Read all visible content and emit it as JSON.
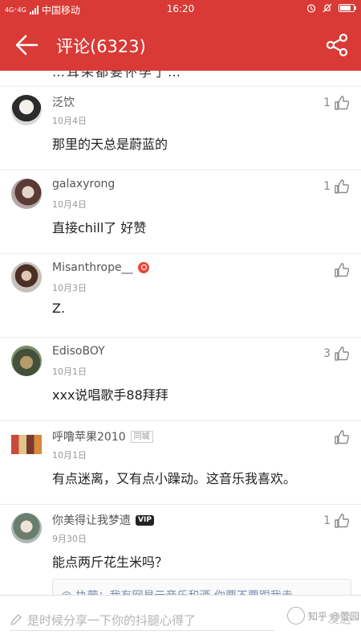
{
  "status_bar": {
    "network": "4G⁺4G",
    "carrier": "中国移动",
    "time": "16:20"
  },
  "header": {
    "title": "评论(6323)"
  },
  "peek_text": "…耳朵都要怀孕了…",
  "comments": [
    {
      "username": "泛饮",
      "date": "10月4日",
      "text": "那里的天总是蔚蓝的",
      "likes": "1",
      "badge": ""
    },
    {
      "username": "galaxyrong",
      "date": "10月4日",
      "text": "直接chill了 好赞",
      "likes": "1",
      "badge": ""
    },
    {
      "username": "Misanthrope__",
      "date": "10月3日",
      "text": "Z.",
      "likes": "",
      "badge": ""
    },
    {
      "username": "EdisoBOY",
      "date": "10月1日",
      "text": "xxx说唱歌手88拜拜",
      "likes": "3",
      "badge": ""
    },
    {
      "username": "呼噜苹果2010",
      "date": "10月1日",
      "text": "有点迷离，又有点小躁动。这音乐我喜欢。",
      "likes": "",
      "badge": "同城"
    },
    {
      "username": "你美得让我梦遗",
      "date": "9月30日",
      "text": "能点两斤花生米吗？",
      "likes": "1",
      "badge": "VIP"
    }
  ],
  "quote": {
    "text": "@ 执营：我有网易云音乐和酒 你要不要跟我走"
  },
  "input": {
    "placeholder": "是时候分享一下你的抖腿心得了",
    "send_label": "发送"
  },
  "watermark": {
    "text": "知乎 @蕾园"
  },
  "colors": {
    "brand": "#d93a36",
    "link": "#7a8fb0"
  }
}
